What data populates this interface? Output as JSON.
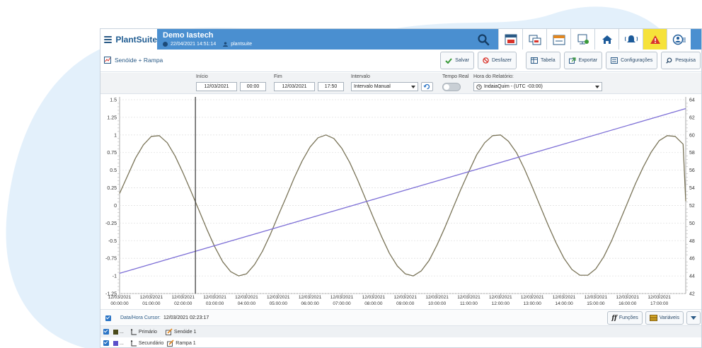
{
  "app": {
    "brand": "PlantSuite",
    "site_name": "Demo Iastech",
    "datetime": "22/04/2021 14:51:14",
    "user": "plantsuite"
  },
  "view": {
    "title": "Senóide + Rampa"
  },
  "actions": {
    "save": "Salvar",
    "undo": "Desfazer",
    "table": "Tabela",
    "export": "Exportar",
    "settings": "Configurações",
    "search": "Pesquisa"
  },
  "filters": {
    "start_label": "Início",
    "start_date": "12/03/2021",
    "start_time": "00:00",
    "end_label": "Fim",
    "end_date": "12/03/2021",
    "end_time": "17:50",
    "interval_label": "Intervalo",
    "interval_value": "Intervalo Manual",
    "realtime_label": "Tempo Real",
    "report_hour_label": "Hora do Relatório:",
    "report_hour_value": "IndaiaQuim - (UTC -03:00)"
  },
  "footer": {
    "cursor_label": "Data/Hora Cursor:",
    "cursor_value": "12/03/2021 02:23:17",
    "functions": "Funções",
    "variables": "Variáveis"
  },
  "series_list": [
    {
      "axis": "Primário",
      "name": "Senóide 1",
      "ellipsis": "...",
      "color": "#4a4a1a"
    },
    {
      "axis": "Secundário",
      "name": "Rampa 1",
      "ellipsis": "...",
      "color": "#5b4fc9"
    }
  ],
  "colors": {
    "header_blue": "#4a8fd0",
    "brand": "#1f5c92",
    "sine": "#7a7458",
    "ramp": "#7d6fd6",
    "warning": "#f6e23a"
  },
  "chart_data": {
    "type": "line",
    "x_start_hour": 0,
    "x_end_hour": 17.833,
    "cursor_hour": 2.388,
    "x_ticks": [
      {
        "date": "12/03/2021",
        "time": "00:00:00",
        "hour": 0
      },
      {
        "date": "12/03/2021",
        "time": "01:00:00",
        "hour": 1
      },
      {
        "date": "12/03/2021",
        "time": "02:00:00",
        "hour": 2
      },
      {
        "date": "12/03/2021",
        "time": "03:00:00",
        "hour": 3
      },
      {
        "date": "12/03/2021",
        "time": "04:00:00",
        "hour": 4
      },
      {
        "date": "12/03/2021",
        "time": "05:00:00",
        "hour": 5
      },
      {
        "date": "12/03/2021",
        "time": "06:00:00",
        "hour": 6
      },
      {
        "date": "12/03/2021",
        "time": "07:00:00",
        "hour": 7
      },
      {
        "date": "12/03/2021",
        "time": "08:00:00",
        "hour": 8
      },
      {
        "date": "12/03/2021",
        "time": "09:00:00",
        "hour": 9
      },
      {
        "date": "12/03/2021",
        "time": "10:00:00",
        "hour": 10
      },
      {
        "date": "12/03/2021",
        "time": "11:00:00",
        "hour": 11
      },
      {
        "date": "12/03/2021",
        "time": "12:00:00",
        "hour": 12
      },
      {
        "date": "12/03/2021",
        "time": "13:00:00",
        "hour": 13
      },
      {
        "date": "12/03/2021",
        "time": "14:00:00",
        "hour": 14
      },
      {
        "date": "12/03/2021",
        "time": "15:00:00",
        "hour": 15
      },
      {
        "date": "12/03/2021",
        "time": "16:00:00",
        "hour": 16
      },
      {
        "date": "12/03/2021",
        "time": "17:00:00",
        "hour": 17
      }
    ],
    "y_left": {
      "min": -1.25,
      "max": 1.5,
      "ticks": [
        "1.5",
        "1.25",
        "1",
        "0.75",
        "0.5",
        "0.25",
        "0",
        "-0.25",
        "-0.5",
        "-0.75",
        "-1",
        "-1.25"
      ]
    },
    "y_right": {
      "min": 42,
      "max": 64,
      "ticks": [
        "64",
        "62",
        "60",
        "58",
        "56",
        "54",
        "52",
        "50",
        "48",
        "46",
        "44",
        "42"
      ]
    },
    "series": [
      {
        "axis": "left",
        "x": [
          0,
          0.25,
          0.5,
          0.75,
          1,
          1.25,
          1.5,
          1.75,
          2,
          2.25,
          2.5,
          2.75,
          3,
          3.25,
          3.5,
          3.75,
          4,
          4.25,
          4.5,
          4.75,
          5,
          5.25,
          5.5,
          5.75,
          6,
          6.25,
          6.5,
          6.75,
          7,
          7.25,
          7.5,
          7.75,
          8,
          8.25,
          8.5,
          8.75,
          9,
          9.25,
          9.5,
          9.75,
          10,
          10.25,
          10.5,
          10.75,
          11,
          11.25,
          11.5,
          11.75,
          12,
          12.25,
          12.5,
          12.75,
          13,
          13.25,
          13.5,
          13.75,
          14,
          14.25,
          14.5,
          14.75,
          15,
          15.25,
          15.5,
          15.75,
          16,
          16.25,
          16.5,
          16.75,
          17,
          17.25,
          17.5,
          17.75,
          17.833
        ],
        "y": [
          0.17,
          0.42,
          0.67,
          0.86,
          0.98,
          0.99,
          0.89,
          0.7,
          0.46,
          0.2,
          -0.07,
          -0.34,
          -0.59,
          -0.8,
          -0.94,
          -1.0,
          -0.97,
          -0.84,
          -0.65,
          -0.41,
          -0.14,
          0.12,
          0.39,
          0.63,
          0.83,
          0.96,
          1.0,
          0.95,
          0.81,
          0.61,
          0.36,
          0.09,
          -0.18,
          -0.44,
          -0.68,
          -0.86,
          -0.97,
          -1.0,
          -0.93,
          -0.78,
          -0.56,
          -0.31,
          -0.04,
          0.23,
          0.48,
          0.72,
          0.89,
          0.99,
          1.0,
          0.91,
          0.75,
          0.52,
          0.26,
          -0.01,
          -0.28,
          -0.53,
          -0.75,
          -0.91,
          -0.99,
          -0.99,
          -0.9,
          -0.73,
          -0.5,
          -0.23,
          0.04,
          0.31,
          0.55,
          0.76,
          0.92,
          0.99,
          0.98,
          0.87,
          0.06
        ]
      },
      {
        "axis": "right",
        "x": [
          0,
          17.833
        ],
        "y": [
          44.3,
          63.0
        ]
      }
    ]
  }
}
